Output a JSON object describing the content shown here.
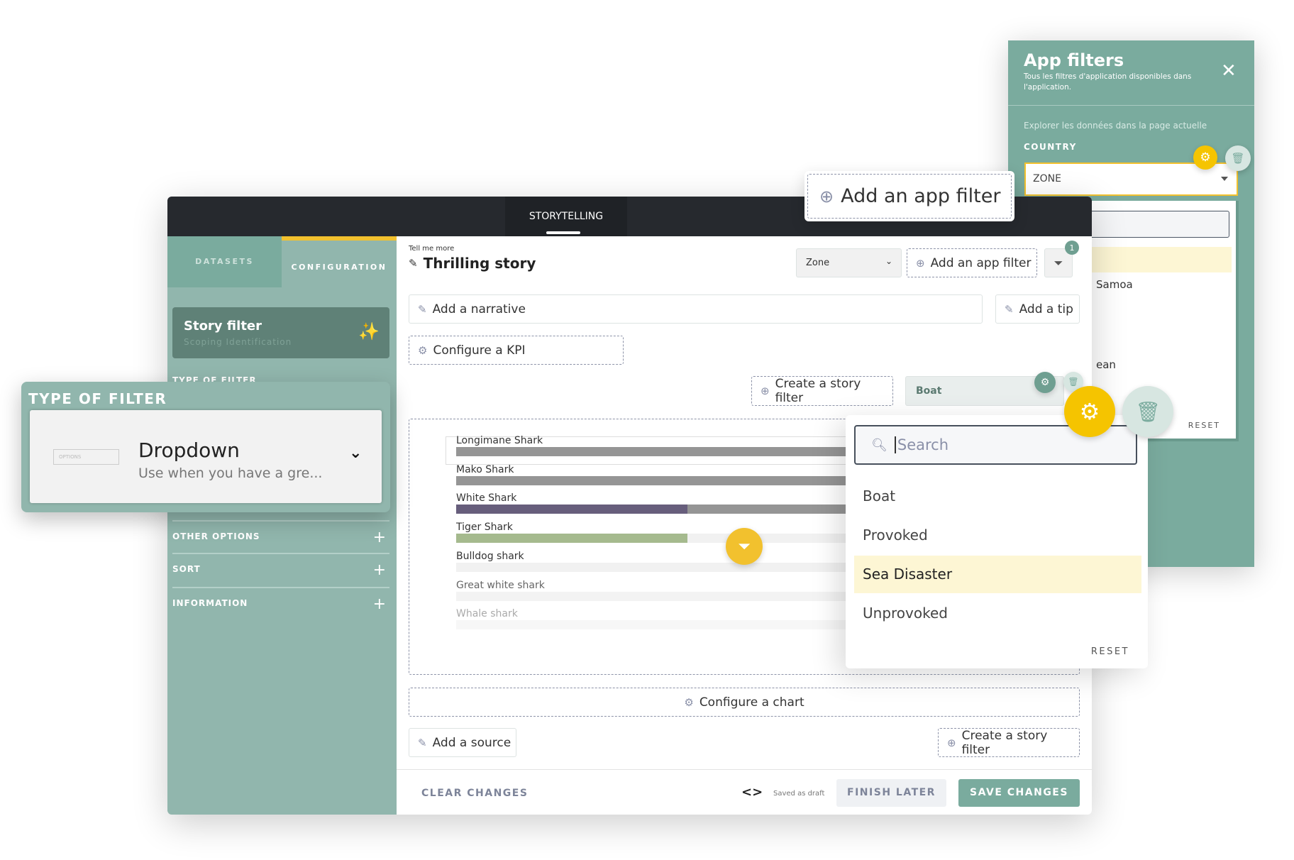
{
  "app_filters": {
    "title": "App filters",
    "subtitle": "Tous les filtres d'application disponibles dans l'application.",
    "explore": "Explorer les données dans la page actuelle",
    "country_label": "COUNTRY",
    "select_value": "ZONE",
    "list_items": [
      "Samoa",
      "ean"
    ],
    "reset": "RESET"
  },
  "topbar": {
    "tab": "STORYTELLING"
  },
  "sidebar": {
    "tabs": [
      "DATASETS",
      "CONFIGURATION"
    ],
    "card_title": "Story filter",
    "card_subtitle": "Scoping Identification",
    "type_label": "TYPE OF FILTER",
    "sections": [
      "OTHER OPTIONS",
      "SORT",
      "INFORMATION"
    ]
  },
  "type_of_filter": {
    "label": "TYPE OF FILTER",
    "thumb": "OPTIONS",
    "title": "Dropdown",
    "desc": "Use when you have a gre..."
  },
  "story": {
    "kicker": "Tell me more",
    "title": "Thrilling story",
    "zone_select": "Zone",
    "add_app_filter": "Add an app filter",
    "filter_badge": "1",
    "add_narrative": "Add a narrative",
    "add_tip": "Add a tip",
    "configure_kpi": "Configure a KPI",
    "create_story_filter": "Create a story filter",
    "boat_select": "Boat",
    "configure_chart": "Configure a chart",
    "add_source": "Add a source"
  },
  "chart": {
    "rows": [
      {
        "label": "Longimane Shark",
        "fill": 1.0,
        "color": "#959595",
        "track": "#959595"
      },
      {
        "label": "Mako Shark",
        "fill": 1.0,
        "color": "#959595",
        "track": "#959595"
      },
      {
        "label": "White Shark",
        "fill": 0.37,
        "color": "#675e7c",
        "track": "#959595"
      },
      {
        "label": "Tiger Shark",
        "fill": 0.37,
        "color": "#a5ba8e",
        "track": "#f1f1f1"
      },
      {
        "label": "Bulldog shark",
        "fill": 0,
        "color": "#f1f1f1",
        "track": "#f1f1f1"
      },
      {
        "label": "Great white shark",
        "fill": 0,
        "color": "#f3f3f3",
        "track": "#f3f3f3"
      },
      {
        "label": "Whale shark",
        "fill": 0,
        "color": "#f7f7f7",
        "track": "#f7f7f7"
      }
    ]
  },
  "popover": {
    "placeholder": "Search",
    "options": [
      "Boat",
      "Provoked",
      "Sea Disaster",
      "Unprovoked"
    ],
    "selected": "Sea Disaster",
    "reset": "RESET"
  },
  "footer": {
    "clear": "CLEAR CHANGES",
    "code_icon": "<>",
    "saved": "Saved as draft",
    "finish": "FINISH LATER",
    "save": "SAVE CHANGES"
  },
  "callout": {
    "label": "Add an app filter"
  },
  "colors": {
    "accent": "#f5c400",
    "teal": "#7aab9e",
    "sidebar": "#91b6ad"
  }
}
